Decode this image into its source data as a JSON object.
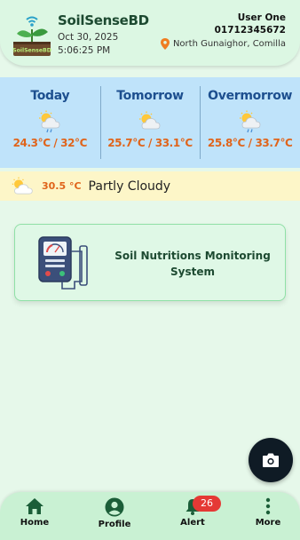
{
  "header": {
    "logo_text": "SoilSenseBD",
    "app_name": "SoilSenseBD",
    "date": "Oct 30, 2025",
    "time": "5:06:25 PM",
    "user_name": "User One",
    "user_phone": "01712345672",
    "user_location": "North Gunaighor, Comilla"
  },
  "forecast": [
    {
      "day": "Today",
      "temp": "24.3°C / 32°C",
      "icon": "rain-sun-cloud-icon"
    },
    {
      "day": "Tomorrow",
      "temp": "25.7°C / 33.1°C",
      "icon": "partly-cloudy-icon"
    },
    {
      "day": "Overmorrow",
      "temp": "25.8°C / 33.7°C",
      "icon": "rain-sun-cloud-icon"
    }
  ],
  "current_weather": {
    "temp": "30.5 °C",
    "condition": "Partly Cloudy",
    "icon": "partly-cloudy-icon"
  },
  "card": {
    "title": "Soil Nutritions Monitoring System",
    "icon": "soil-meter-icon"
  },
  "fab": {
    "icon": "camera-icon"
  },
  "nav": {
    "home": "Home",
    "profile": "Profile",
    "alert": "Alert",
    "alert_count": "26",
    "more": "More"
  },
  "colors": {
    "brand_green": "#1d4a31",
    "forecast_bg": "#bfe3fa",
    "temp_orange": "#e0641b",
    "badge_red": "#e53935"
  }
}
